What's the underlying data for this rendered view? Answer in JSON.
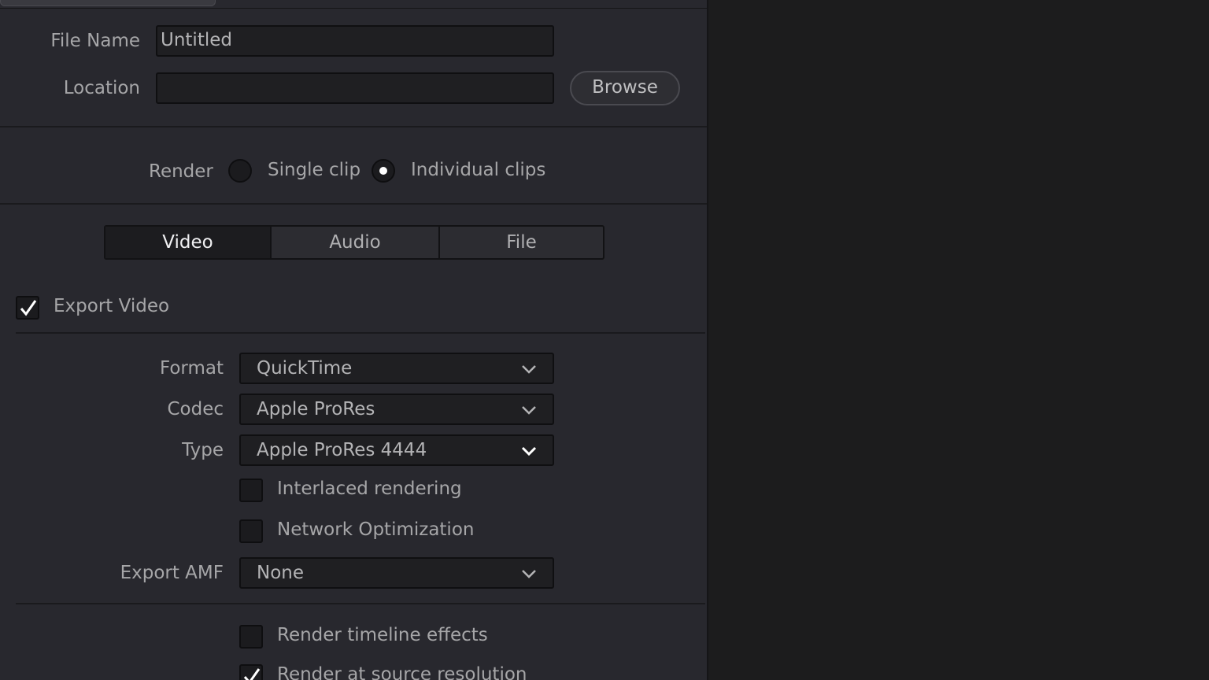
{
  "file": {
    "name_label": "File Name",
    "name_value": "Untitled",
    "location_label": "Location",
    "location_value": "",
    "browse_label": "Browse"
  },
  "render": {
    "label": "Render",
    "options": [
      "Single clip",
      "Individual clips"
    ],
    "selected": "Individual clips"
  },
  "tabs": [
    {
      "label": "Video",
      "active": true
    },
    {
      "label": "Audio",
      "active": false
    },
    {
      "label": "File",
      "active": false
    }
  ],
  "export_video": {
    "label": "Export Video",
    "checked": true
  },
  "video": {
    "format_label": "Format",
    "format_value": "QuickTime",
    "codec_label": "Codec",
    "codec_value": "Apple ProRes",
    "type_label": "Type",
    "type_value": "Apple ProRes 4444",
    "interlaced_label": "Interlaced rendering",
    "interlaced_checked": false,
    "network_label": "Network Optimization",
    "network_checked": false,
    "amf_label": "Export AMF",
    "amf_value": "None"
  },
  "options": {
    "timeline_effects_label": "Render timeline effects",
    "timeline_effects_checked": false,
    "source_resolution_label": "Render at source resolution",
    "source_resolution_checked": true
  }
}
